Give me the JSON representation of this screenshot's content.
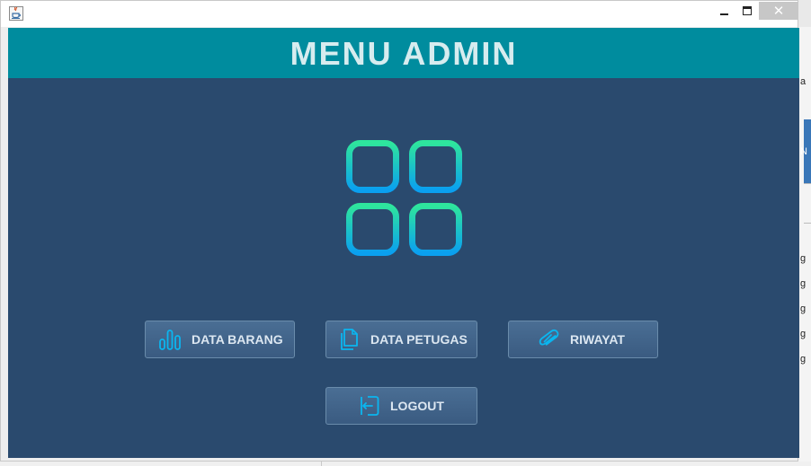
{
  "window": {
    "title": "",
    "controls": {
      "minimize": "minimize",
      "maximize": "maximize",
      "close": "✕"
    }
  },
  "header": {
    "title": "MENU ADMIN"
  },
  "logo": {
    "icon": "grid-apps-icon",
    "gradient_top": "#2ee59d",
    "gradient_bottom": "#0aa0f0"
  },
  "menu": {
    "buttons": [
      {
        "label": "DATA BARANG",
        "icon": "bar-chart-icon"
      },
      {
        "label": "DATA PETUGAS",
        "icon": "documents-icon"
      },
      {
        "label": "RIWAYAT",
        "icon": "paperclip-icon"
      },
      {
        "label": "LOGOUT",
        "icon": "logout-icon"
      }
    ]
  },
  "background_window": {
    "fragments": [
      "a",
      "N",
      "g",
      "g",
      "g",
      "g",
      "g"
    ]
  },
  "colors": {
    "header_bg": "#008c9e",
    "content_bg": "#2a4a6e",
    "button_bg": "#3f6289",
    "icon_accent": "#0ab6f0"
  }
}
